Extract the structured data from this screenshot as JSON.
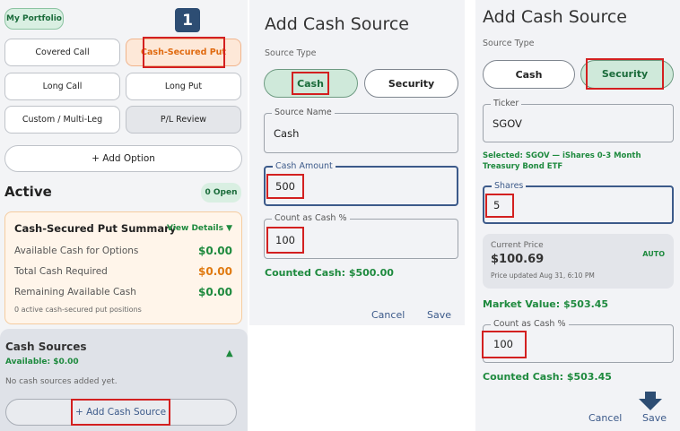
{
  "panel1": {
    "portfolio_tab": "My Portfolio",
    "step_badge": "1",
    "options": [
      "Covered Call",
      "Cash-Secured Put",
      "Long Call",
      "Long Put",
      "Custom / Multi-Leg",
      "P/L Review"
    ],
    "add_option": "+ Add Option",
    "active_title": "Active",
    "open_badge": "0 Open",
    "summary": {
      "title": "Cash-Secured Put Summary",
      "view_details": "View Details",
      "rows": [
        {
          "label": "Available Cash for Options",
          "value": "$0.00",
          "color": "#1e8a3e"
        },
        {
          "label": "Total Cash Required",
          "value": "$0.00",
          "color": "#e07a10"
        },
        {
          "label": "Remaining Available Cash",
          "value": "$0.00",
          "color": "#1e8a3e"
        }
      ],
      "footnote": "0 active cash-secured put positions"
    },
    "cash_sources": {
      "title": "Cash Sources",
      "available": "Available: $0.00",
      "empty": "No cash sources added yet.",
      "add_button": "+ Add Cash Source"
    }
  },
  "panel2": {
    "title": "Add Cash Source",
    "source_type": "Source Type",
    "toggle_cash": "Cash",
    "toggle_security": "Security",
    "source_name_label": "Source Name",
    "source_name_value": "Cash",
    "cash_amount_label": "Cash Amount",
    "cash_amount_value": "500",
    "count_label": "Count as Cash %",
    "count_value": "100",
    "counted": "Counted Cash: $500.00",
    "cancel": "Cancel",
    "save": "Save"
  },
  "panel3": {
    "title": "Add Cash Source",
    "source_type": "Source Type",
    "toggle_cash": "Cash",
    "toggle_security": "Security",
    "ticker_label": "Ticker",
    "ticker_value": "SGOV",
    "selected": "Selected: SGOV — iShares 0-3 Month Treasury Bond ETF",
    "shares_label": "Shares",
    "shares_value": "5",
    "price_label": "Current Price",
    "price_value": "$100.69",
    "auto": "AUTO",
    "price_updated": "Price updated Aug 31, 6:10 PM",
    "market_value": "Market Value: $503.45",
    "count_label": "Count as Cash %",
    "count_value": "100",
    "counted": "Counted Cash: $503.45",
    "cancel": "Cancel",
    "save": "Save"
  }
}
